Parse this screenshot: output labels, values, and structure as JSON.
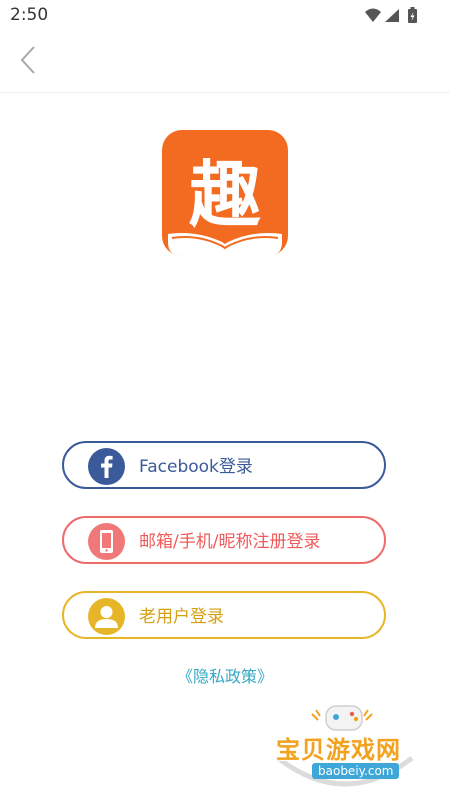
{
  "status_bar": {
    "time": "2:50"
  },
  "icons": {
    "back": "chevron-left-icon",
    "wifi": "wifi-icon",
    "signal": "signal-icon",
    "battery": "battery-icon",
    "logo": "qu-book-logo-icon",
    "facebook": "facebook-icon",
    "phone": "phone-icon",
    "user": "user-icon"
  },
  "colors": {
    "logo_orange": "#f26b21",
    "facebook_blue": "#3b5a9a",
    "register_red": "#f06a6a",
    "olduser_yellow": "#e7b628",
    "privacy_link": "#35a9c6"
  },
  "logo": {
    "character": "趣"
  },
  "login": {
    "facebook_label": "Facebook登录",
    "register_label": "邮箱/手机/昵称注册登录",
    "olduser_label": "老用户登录"
  },
  "privacy": {
    "label": "《隐私政策》"
  },
  "watermark": {
    "title": "宝贝游戏网",
    "url": "baobeiy.com"
  }
}
